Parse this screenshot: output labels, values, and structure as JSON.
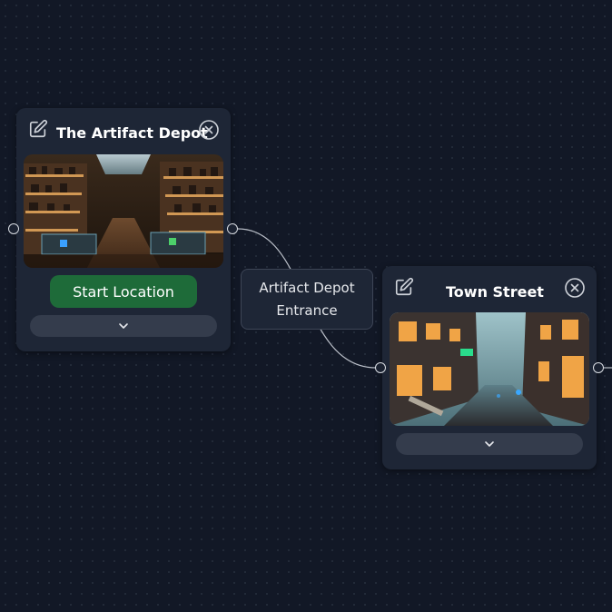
{
  "nodes": [
    {
      "title": "The Artifact Depot",
      "image_alt": "Artifact shop interior with shelves",
      "start_label": "Start Location",
      "edit_icon": "edit-icon",
      "close_icon": "close-circle-icon",
      "expand_icon": "chevron-down-icon"
    },
    {
      "title": "Town Street",
      "image_alt": "Foggy town street alley at night",
      "edit_icon": "edit-icon",
      "close_icon": "close-circle-icon",
      "expand_icon": "chevron-down-icon"
    }
  ],
  "edge": {
    "label_line1": "Artifact Depot",
    "label_line2": "Entrance"
  },
  "colors": {
    "canvas_bg": "#121826",
    "node_bg": "#1e2636",
    "start_button": "#1e6b39",
    "expand_button": "#343c4c"
  }
}
